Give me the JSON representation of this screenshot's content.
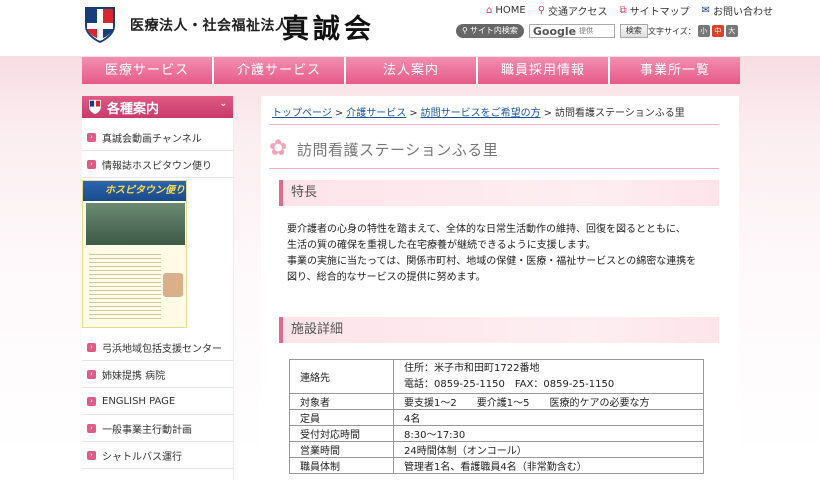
{
  "header": {
    "org_prefix": "医療法人・社会福祉法人",
    "org_name": "真誠会",
    "top_links": [
      {
        "icon": "home-icon",
        "label": "HOME"
      },
      {
        "icon": "map-pin-icon",
        "label": "交通アクセス"
      },
      {
        "icon": "sitemap-icon",
        "label": "サイトマップ"
      },
      {
        "icon": "mail-icon",
        "label": "お問い合わせ"
      }
    ],
    "site_search_label": "サイト内検索",
    "search_google": "Google",
    "search_provided": "提供",
    "search_button": "検索",
    "font_size_label": "文字サイズ：",
    "font_sizes": [
      "小",
      "中",
      "大"
    ],
    "font_size_selected": "中"
  },
  "nav": {
    "items": [
      "医療サービス",
      "介護サービス",
      "法人案内",
      "職員採用情報",
      "事業所一覧"
    ]
  },
  "sidebar": {
    "heading": "各種案内",
    "items_top": [
      "真誠会動画チャンネル",
      "情報誌ホスピタウン便り"
    ],
    "banner_title": "ホスピタウン便り",
    "items_bottom": [
      "弓浜地域包括支援センター",
      "姉妹提携 病院",
      "ENGLISH PAGE",
      "一般事業主行動計画",
      "シャトルバス運行"
    ]
  },
  "breadcrumb": {
    "items": [
      "トップページ",
      "介護サービス",
      "訪問サービスをご希望の方"
    ],
    "current": "訪問看護ステーションふる里",
    "separator": ">"
  },
  "page": {
    "title": "訪問看護ステーションふる里",
    "features_heading": "特長",
    "features_lines": [
      "要介護者の心身の特性を踏まえて、全体的な日常生活動作の維持、回復を図るとともに、",
      "生活の質の確保を重視した在宅療養が継続できるように支援します。",
      "事業の実施に当たっては、関係市町村、地域の保健・医療・福祉サービスとの綿密な連携を",
      "図り、総合的なサービスの提供に努めます。"
    ],
    "details_heading": "施設詳細",
    "details": {
      "contact_key": "連絡先",
      "contact_address": "住所：米子市和田町1722番地",
      "contact_phone": "電話：0859-25-1150　FAX：0859-25-1150",
      "rows": [
        {
          "key": "対象者",
          "value": "要支援1～2　　要介護1～5　　医療的ケアの必要な方"
        },
        {
          "key": "定員",
          "value": "4名"
        },
        {
          "key": "受付対応時間",
          "value": "8:30～17:30"
        },
        {
          "key": "営業時間",
          "value": "24時間体制（オンコール）"
        },
        {
          "key": "職員体制",
          "value": "管理者1名、看護職員4名（非常勤含む）"
        }
      ]
    }
  },
  "colors": {
    "accent_pink": "#e65a8a",
    "sidebar_head": "#c83a6a",
    "link_blue": "#1a56a0"
  }
}
